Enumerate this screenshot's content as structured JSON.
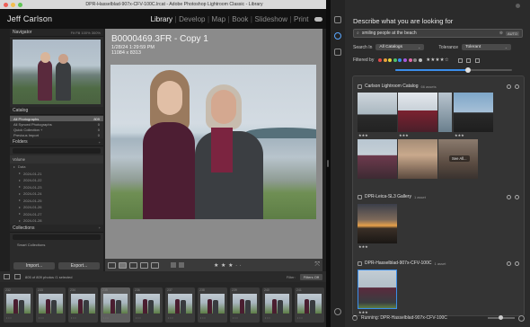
{
  "window": {
    "title": "DPR-Hasselblad-907x-CFV-100C.lrcat - Adobe Photoshop Lightroom Classic - Library",
    "traffic_colors": [
      "#ee5f57",
      "#f4be4f",
      "#5fc454"
    ]
  },
  "identity": {
    "name": "Jeff Carlson",
    "modules": [
      "Library",
      "Develop",
      "Map",
      "Book",
      "Slideshow",
      "Print"
    ],
    "active_module": "Library",
    "separator": "|"
  },
  "left_panel": {
    "navigator": {
      "title": "Navigator",
      "options": "Fit  Fill  100%  300%"
    },
    "catalog": {
      "title": "Catalog",
      "items": [
        {
          "label": "All Photographs",
          "count": "809"
        },
        {
          "label": "All Synced Photographs",
          "count": "0"
        },
        {
          "label": "Quick Collection +",
          "count": "0"
        },
        {
          "label": "Previous Import",
          "count": "0"
        }
      ]
    },
    "folders": {
      "title": "Folders",
      "volume": "Volume",
      "volume_info": "",
      "root": "Data",
      "items": [
        {
          "label": "2024-01-21",
          "count": ""
        },
        {
          "label": "2024-01-22",
          "count": ""
        },
        {
          "label": "2024-01-23",
          "count": ""
        },
        {
          "label": "2024-01-24",
          "count": ""
        },
        {
          "label": "2024-01-25",
          "count": ""
        },
        {
          "label": "2024-01-26",
          "count": ""
        },
        {
          "label": "2024-01-27",
          "count": ""
        },
        {
          "label": "2024-01-28",
          "count": ""
        }
      ]
    },
    "collections": {
      "title": "Collections",
      "items": [
        "Smart Collections"
      ]
    },
    "import_label": "Import...",
    "export_label": "Export..."
  },
  "loupe": {
    "filename": "B0000469.3FR - Copy 1",
    "datetime": "1/28/24 1:29:59 PM",
    "dimensions": "11084 x 8313"
  },
  "toolbar": {
    "stars": "★ ★ ★ · ·"
  },
  "filmbar": {
    "info": "805 of 809 photos /1 selected",
    "filter_label": "Filter:",
    "filter_value": "Filters Off"
  },
  "filmstrip": {
    "numbers": [
      "232",
      "233",
      "234",
      "235",
      "236",
      "237",
      "238",
      "239",
      "240",
      "241"
    ],
    "dots": "• • •"
  },
  "app": {
    "prompt_title": "Describe what you are looking for",
    "search": {
      "value": "smiling people at the beach",
      "auto_label": "AUTO"
    },
    "search_in_label": "Search In",
    "search_in_value": "All Catalogs",
    "tolerance_label": "Tolerance",
    "tolerance_value": "Tolerant",
    "filtered_by_label": "Filtered by",
    "color_labels": [
      "#e04848",
      "#e8a23c",
      "#e3d23b",
      "#4ec26c",
      "#3a8ff0",
      "#a45be0",
      "#e06aa8",
      "#888888",
      "#bfbfbf"
    ],
    "filter_stars": "★★★★☆",
    "tolerance_slider": 0.62,
    "groups": [
      {
        "name": "Carlson Lightroom Catalog",
        "count": "66 assets"
      },
      {
        "name": "DPR-Leica-SL3 Gallery",
        "count": "1 asset"
      },
      {
        "name": "DPR-Hasselblad-907x-CFV-100C",
        "count": "1 asset"
      }
    ],
    "see_all": "See All...",
    "thumb_dots": "★★★",
    "status": "Running: DPR-Hasselblad-907x-CFV-100C"
  }
}
